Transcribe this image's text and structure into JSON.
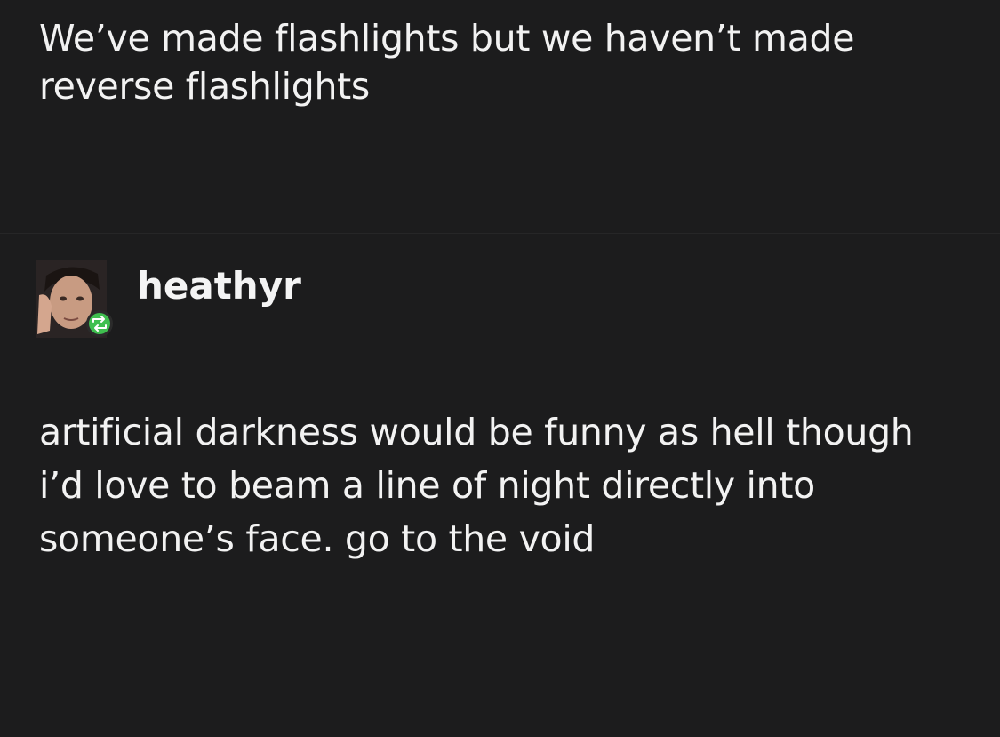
{
  "post": {
    "original_text": "We’ve made flashlights but we haven’t made reverse flashlights"
  },
  "reblog": {
    "username": "heathyr",
    "avatar_icon": "user-avatar-icon",
    "badge_icon": "reblog-icon",
    "badge_color": "#3fbf4f",
    "text": "artificial darkness would be funny as hell though i’d love to beam a line of night directly into someone’s face. go to the void"
  }
}
